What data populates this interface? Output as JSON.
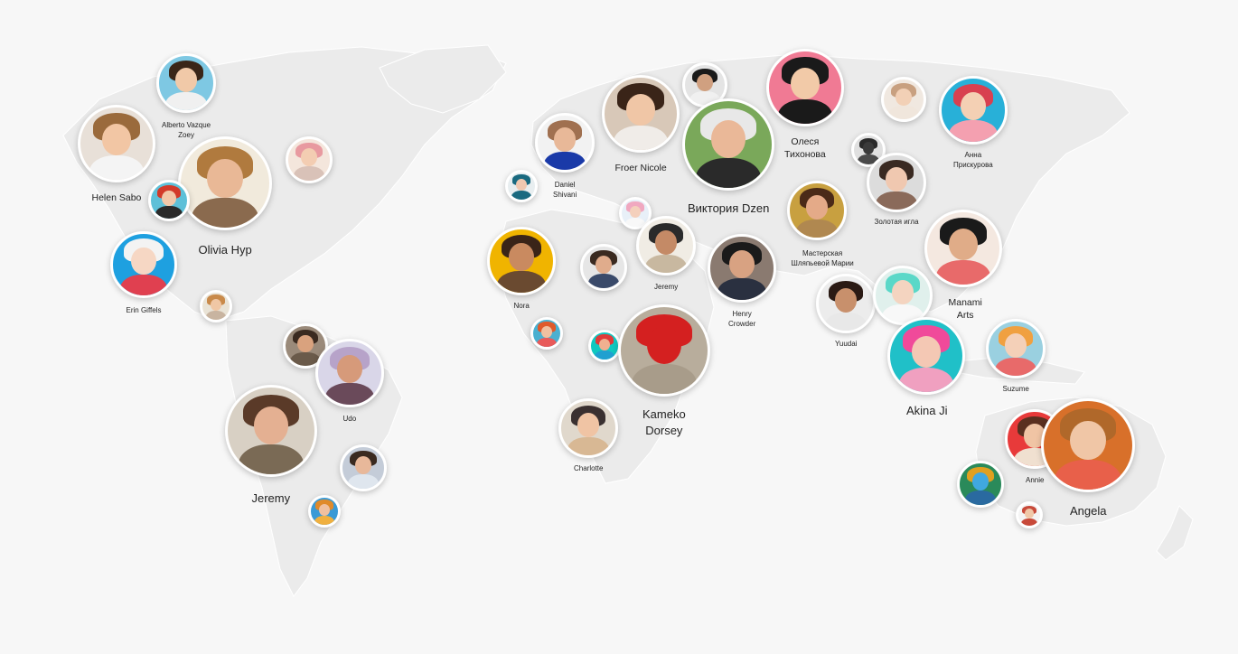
{
  "map": {
    "background": "#f7f7f7",
    "land_color": "#ebebeb",
    "border_color": "#ffffff"
  },
  "people": [
    {
      "id": "alberto",
      "line1": "Alberto Vazque",
      "line2": "Zoey",
      "bg": "#7ec8e3",
      "hair": "#3a2618",
      "skin": "#f1c9a8",
      "body": "#f0f0f0"
    },
    {
      "id": "helen",
      "line1": "Helen Sabo",
      "line2": "",
      "bg": "#e8e0d8",
      "hair": "#9a6a3c",
      "skin": "#f2c6a4",
      "body": "#f4f4f4"
    },
    {
      "id": "olivia",
      "line1": "Olivia Hyp",
      "line2": "",
      "bg": "#f1eadc",
      "hair": "#b07a3e",
      "skin": "#e9b896",
      "body": "#8a6a4e"
    },
    {
      "id": "pinkhat",
      "line1": "",
      "line2": "",
      "bg": "#f4e6dc",
      "hair": "#e89aa0",
      "skin": "#f3cdb2",
      "body": "#d9c2b8"
    },
    {
      "id": "redhead",
      "line1": "",
      "line2": "",
      "bg": "#5ec0d8",
      "hair": "#d23a2a",
      "skin": "#f2c7a8",
      "body": "#2a2a2a"
    },
    {
      "id": "erin",
      "line1": "Erin Giffels",
      "line2": "",
      "bg": "#1ea0e0",
      "hair": "#f3f3f3",
      "skin": "#f6d7c4",
      "body": "#e04050"
    },
    {
      "id": "small_na",
      "line1": "",
      "line2": "",
      "bg": "#e9e3d6",
      "hair": "#c98a4a",
      "skin": "#f0c7a5",
      "body": "#c8b4a0"
    },
    {
      "id": "man_sa",
      "line1": "",
      "line2": "",
      "bg": "#9a8a7a",
      "hair": "#3a2a20",
      "skin": "#d9a27e",
      "body": "#6a5a4a"
    },
    {
      "id": "udo",
      "line1": "Udo",
      "line2": "",
      "bg": "#d9d6e8",
      "hair": "#b7a3c9",
      "skin": "#d69a7a",
      "body": "#6a4a5a"
    },
    {
      "id": "jeremy_sa",
      "line1": "Jeremy",
      "line2": "",
      "bg": "#d8d0c4",
      "hair": "#5a3a28",
      "skin": "#e4b092",
      "body": "#7a6a55"
    },
    {
      "id": "man_sa2",
      "line1": "",
      "line2": "",
      "bg": "#c4ccd8",
      "hair": "#3a2a20",
      "skin": "#e8b89a",
      "body": "#dfe6ee"
    },
    {
      "id": "small_sa",
      "line1": "",
      "line2": "",
      "bg": "#3a9ad6",
      "hair": "#e08a2a",
      "skin": "#f0c0a0",
      "body": "#f0b040"
    },
    {
      "id": "bowtie",
      "line1": "Daniel",
      "line2": "Shivani",
      "bg": "#f2f2f2",
      "hair": "#a07050",
      "skin": "#e8b898",
      "body": "#1a3aa8"
    },
    {
      "id": "teal",
      "line1": "",
      "line2": "",
      "bg": "#e8eef0",
      "hair": "#1a6a80",
      "skin": "#f0c8b0",
      "body": "#1a6a80"
    },
    {
      "id": "froer",
      "line1": "Froer Nicole",
      "line2": "",
      "bg": "#d8c8b8",
      "hair": "#3a2418",
      "skin": "#f0c6a6",
      "body": "#f0ece8"
    },
    {
      "id": "man_eu",
      "line1": "",
      "line2": "",
      "bg": "#e4e4e4",
      "hair": "#1a1a1a",
      "skin": "#d0a080",
      "body": "#f0f0f0"
    },
    {
      "id": "viktoria",
      "line1": "Виктория Dzen",
      "line2": "",
      "bg": "#7aa85a",
      "hair": "#e8e8e8",
      "skin": "#eab898",
      "body": "#2a2a2a"
    },
    {
      "id": "olesya",
      "line1": "Олеся",
      "line2": "Тихонова",
      "bg": "#f07a94",
      "hair": "#1a1a1a",
      "skin": "#f2caa8",
      "body": "#1a1a1a"
    },
    {
      "id": "beanie",
      "line1": "",
      "line2": "",
      "bg": "#f0e8e0",
      "hair": "#c8a080",
      "skin": "#f2d0b6",
      "body": "#f0e6dc"
    },
    {
      "id": "anna",
      "line1": "Анна",
      "line2": "Прискурова",
      "bg": "#28b0d8",
      "hair": "#d84050",
      "skin": "#f4d0b4",
      "body": "#f4a0b0"
    },
    {
      "id": "silhouette",
      "line1": "",
      "line2": "",
      "bg": "#e0e0e0",
      "hair": "#2a2a2a",
      "skin": "#3a3a3a",
      "body": "#4a4a4a"
    },
    {
      "id": "zolotaya",
      "line1": "Золотая игла",
      "line2": "",
      "bg": "#dcdcdc",
      "hair": "#3a2a22",
      "skin": "#f0c8b0",
      "body": "#8a6a5a"
    },
    {
      "id": "masterskaya",
      "line1": "Мастерская",
      "line2": "Шляпьевой Марии",
      "bg": "#c8a040",
      "hair": "#4a2a18",
      "skin": "#e4aa88",
      "body": "#b08850"
    },
    {
      "id": "pinkhair",
      "line1": "",
      "line2": "",
      "bg": "#e8f0f8",
      "hair": "#f0a8c0",
      "skin": "#f4d0bc",
      "body": "#f8f8f8"
    },
    {
      "id": "nora",
      "line1": "Nora",
      "line2": "",
      "bg": "#f0b400",
      "hair": "#3a2418",
      "skin": "#c98a60",
      "body": "#6a4a30"
    },
    {
      "id": "man_af",
      "line1": "",
      "line2": "",
      "bg": "#e6e6e6",
      "hair": "#3a2a20",
      "skin": "#e0ac8c",
      "body": "#3a4a6a"
    },
    {
      "id": "jeremy_af",
      "line1": "Jeremy",
      "line2": "",
      "bg": "#f0ece4",
      "hair": "#2a2a2a",
      "skin": "#c48a66",
      "body": "#c8b8a0"
    },
    {
      "id": "henry",
      "line1": "Henry",
      "line2": "Crowder",
      "bg": "#8a7a70",
      "hair": "#1a1a1a",
      "skin": "#d8a282",
      "body": "#2a3040"
    },
    {
      "id": "small_af",
      "line1": "",
      "line2": "",
      "bg": "#4ab0d0",
      "hair": "#e05a2a",
      "skin": "#f0c0a0",
      "body": "#e85a5a"
    },
    {
      "id": "small_af2",
      "line1": "",
      "line2": "",
      "bg": "#10c8c0",
      "hair": "#e03a3a",
      "skin": "#f0b090",
      "body": "#20a0d0"
    },
    {
      "id": "kameko",
      "line1": "Kameko",
      "line2": "Dorsey",
      "bg": "#b8ad9c",
      "hair": "#d42020",
      "skin": "#d42020",
      "body": "#a89c8a"
    },
    {
      "id": "charlotte",
      "line1": "Charlotte",
      "line2": "",
      "bg": "#e0d8cc",
      "hair": "#3a3030",
      "skin": "#f0c4a4",
      "body": "#d8b894"
    },
    {
      "id": "yuudai",
      "line1": "Yuudai",
      "line2": "",
      "bg": "#ececec",
      "hair": "#2a1a14",
      "skin": "#c8906c",
      "body": "#e8e8e8"
    },
    {
      "id": "cosplay",
      "line1": "",
      "line2": "",
      "bg": "#e0f0ec",
      "hair": "#5ad8c8",
      "skin": "#f4d4c0",
      "body": "#f8f8f8"
    },
    {
      "id": "manami",
      "line1": "Manami",
      "line2": "Arts",
      "bg": "#f4e8e0",
      "hair": "#1a1a1a",
      "skin": "#e0ac88",
      "body": "#e86a6a"
    },
    {
      "id": "akina",
      "line1": "Akina Ji",
      "line2": "",
      "bg": "#20c0c8",
      "hair": "#f04a9a",
      "skin": "#f4c8b4",
      "body": "#f0a0c0"
    },
    {
      "id": "suzume",
      "line1": "Suzume",
      "line2": "",
      "bg": "#9ad0e0",
      "hair": "#f0a040",
      "skin": "#f4d0b8",
      "body": "#e86a6a"
    },
    {
      "id": "annie",
      "line1": "Annie",
      "line2": "",
      "bg": "#e83a3a",
      "hair": "#5a3020",
      "skin": "#f0c4a4",
      "body": "#f0e0d0"
    },
    {
      "id": "angela",
      "line1": "Angela",
      "line2": "",
      "bg": "#d8702a",
      "hair": "#b0682a",
      "skin": "#f0c6a6",
      "body": "#e8604a"
    },
    {
      "id": "flowers",
      "line1": "",
      "line2": "",
      "bg": "#2a8a5a",
      "hair": "#e0a020",
      "skin": "#40a8e0",
      "body": "#2a6aa0"
    },
    {
      "id": "tiny_au",
      "line1": "",
      "line2": "",
      "bg": "#f4f4f4",
      "hair": "#c84a3a",
      "skin": "#f0c8a8",
      "body": "#c84a3a"
    }
  ]
}
